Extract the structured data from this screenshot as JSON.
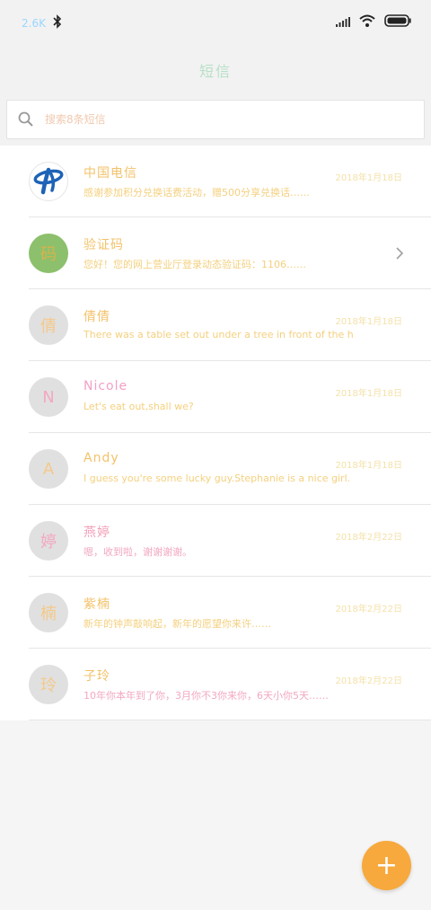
{
  "status_bar": {
    "speed": "2.6K"
  },
  "app": {
    "title": "短信"
  },
  "search": {
    "placeholder": "搜索8条短信"
  },
  "conversations": [
    {
      "name": "中国电信",
      "time": "2018年1月18日",
      "snippet": "感谢参加积分兑换话费活动，赠500分享兑换话……",
      "avatar_text": "",
      "avatar_icon": "telecom-logo"
    },
    {
      "name": "验证码",
      "time": "",
      "snippet": "您好！您的网上营业厅登录动态验证码：1106……",
      "avatar_text": "码",
      "avatar_icon": ""
    },
    {
      "name": "倩倩",
      "time": "2018年1月18日",
      "snippet": "There was a table set out under a tree in front of the hous",
      "avatar_text": "倩",
      "avatar_icon": ""
    },
    {
      "name": "Nicole",
      "time": "2018年1月18日",
      "snippet": "Let's eat out,shall we?",
      "avatar_text": "N",
      "avatar_icon": ""
    },
    {
      "name": "Andy",
      "time": "2018年1月18日",
      "snippet": "I guess you're some lucky guy.Stephanie is a nice girl.",
      "avatar_text": "A",
      "avatar_icon": ""
    },
    {
      "name": "燕婷",
      "time": "2018年2月22日",
      "snippet": "嗯，收到啦，谢谢谢谢。",
      "avatar_text": "婷",
      "avatar_icon": ""
    },
    {
      "name": "紫楠",
      "time": "2018年2月22日",
      "snippet": "新年的钟声敲响起，新年的愿望你来许……",
      "avatar_text": "楠",
      "avatar_icon": ""
    },
    {
      "name": "子玲",
      "time": "2018年2月22日",
      "snippet": "10年你本年到了你，3月你不3你来你，6天小你5天……",
      "avatar_text": "玲",
      "avatar_icon": ""
    }
  ],
  "fab": {
    "label": "+"
  }
}
